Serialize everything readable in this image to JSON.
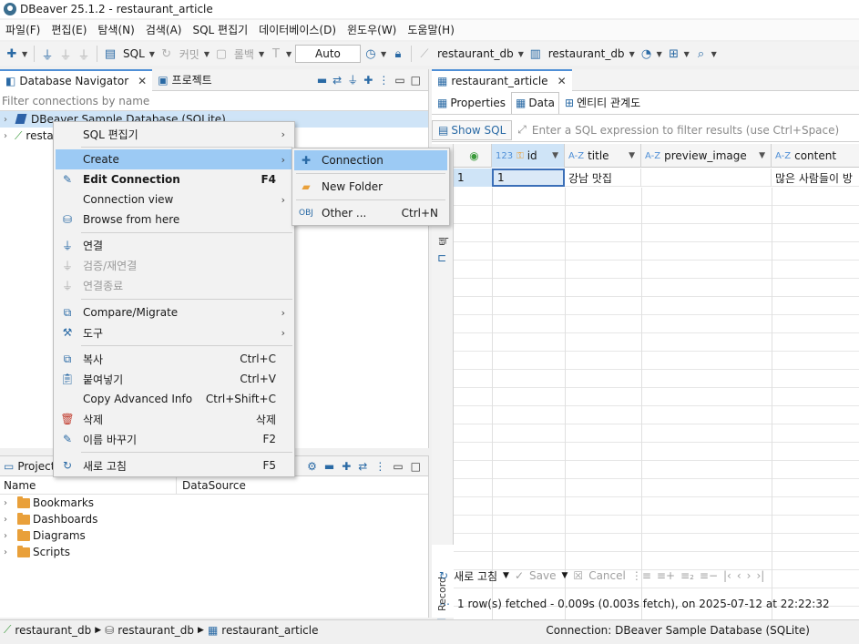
{
  "window": {
    "title": "DBeaver 25.1.2 - restaurant_article"
  },
  "menu": [
    "파일(F)",
    "편집(E)",
    "탐색(N)",
    "검색(A)",
    "SQL 편집기",
    "데이터베이스(D)",
    "윈도우(W)",
    "도움말(H)"
  ],
  "toolbar": {
    "sql_label": "SQL",
    "commit_label": "커밋",
    "rollback_label": "롤백",
    "tx_mode": "Auto",
    "datasource_1": "restaurant_db",
    "datasource_2": "restaurant_db"
  },
  "navigator": {
    "tab_label": "Database Navigator",
    "tab2_label": "프로젝트",
    "filter_placeholder": "Filter connections by name",
    "tree": [
      {
        "label": "DBeaver Sample Database (SQLite)"
      },
      {
        "label": "resta"
      }
    ]
  },
  "projects": {
    "tab_label": "Project",
    "col_name": "Name",
    "col_datasource": "DataSource",
    "items": [
      "Bookmarks",
      "Dashboards",
      "Diagrams",
      "Scripts"
    ]
  },
  "editor": {
    "tab_label": "restaurant_article",
    "subtabs": [
      "Properties",
      "Data",
      "엔티티 관계도"
    ],
    "show_sql": "Show SQL",
    "filter_placeholder": "Enter a SQL expression to filter results (use Ctrl+Space)",
    "columns": [
      {
        "type": "123",
        "name": "id"
      },
      {
        "type": "A-Z",
        "name": "title"
      },
      {
        "type": "A-Z",
        "name": "preview_image"
      },
      {
        "type": "A-Z",
        "name": "content"
      }
    ],
    "rows": [
      {
        "num": "1",
        "id": "1",
        "title": "강남 맛집",
        "preview_image": "",
        "content": "많은 사람들이 방"
      }
    ],
    "side_label_1": "텍스트",
    "side_label_2": "Record",
    "refresh_label": "새로 고침",
    "save_label": "Save",
    "cancel_label": "Cancel",
    "status": "1 row(s) fetched - 0.009s (0.003s fetch), on 2025-07-12 at 22:22:32"
  },
  "context_menu": {
    "items": [
      {
        "label": "SQL 편집기",
        "shortcut": "",
        "submenu": true
      },
      {
        "label": "Create",
        "shortcut": "",
        "submenu": true,
        "highlighted": true
      },
      {
        "label": "Edit Connection",
        "shortcut": "F4",
        "bold": true
      },
      {
        "label": "Connection view",
        "shortcut": "",
        "submenu": true
      },
      {
        "label": "Browse from here",
        "shortcut": ""
      },
      {
        "label": "연결",
        "shortcut": ""
      },
      {
        "label": "검증/재연결",
        "shortcut": "",
        "disabled": true
      },
      {
        "label": "연결종료",
        "shortcut": "",
        "disabled": true
      },
      {
        "label": "Compare/Migrate",
        "shortcut": "",
        "submenu": true
      },
      {
        "label": "도구",
        "shortcut": "",
        "submenu": true
      },
      {
        "label": "복사",
        "shortcut": "Ctrl+C"
      },
      {
        "label": "붙여넣기",
        "shortcut": "Ctrl+V"
      },
      {
        "label": "Copy Advanced Info",
        "shortcut": "Ctrl+Shift+C"
      },
      {
        "label": "삭제",
        "shortcut": "삭제"
      },
      {
        "label": "이름 바꾸기",
        "shortcut": "F2"
      },
      {
        "label": "새로 고침",
        "shortcut": "F5"
      }
    ],
    "create_submenu": [
      {
        "label": "Connection",
        "shortcut": "",
        "highlighted": true
      },
      {
        "label": "New Folder",
        "shortcut": ""
      },
      {
        "label": "Other ...",
        "shortcut": "Ctrl+N"
      }
    ]
  },
  "statusbar": {
    "breadcrumb": [
      "restaurant_db",
      "restaurant_db",
      "restaurant_article"
    ],
    "connection": "Connection: DBeaver Sample Database (SQLite)"
  },
  "colors": {
    "accent": "#4f8fd6",
    "highlight": "#9ccaf4",
    "selection": "#cfe4f7"
  }
}
